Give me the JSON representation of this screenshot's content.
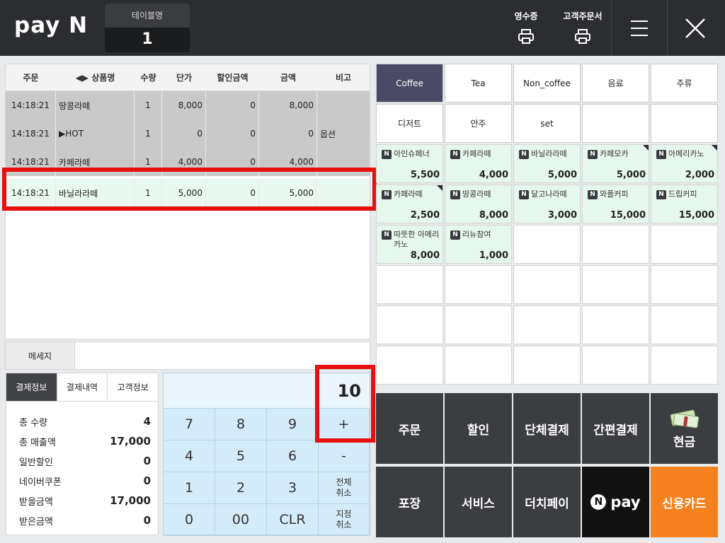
{
  "header": {
    "logo": "pay N",
    "table_label": "테이블명",
    "table_number": "1",
    "receipt_label": "영수증",
    "customer_order_label": "고객주문서"
  },
  "order_table": {
    "columns": [
      "주문",
      "◀▶ 상품명",
      "수량",
      "단가",
      "할인금액",
      "금액",
      "비고"
    ],
    "rows": [
      {
        "time": "14:18:21",
        "name": "땅콩라떼",
        "qty": "1",
        "price": "8,000",
        "discount": "0",
        "amount": "8,000",
        "note": ""
      },
      {
        "time": "14:18:21",
        "name": "▶HOT",
        "qty": "1",
        "price": "0",
        "discount": "0",
        "amount": "0",
        "note": "옵션"
      },
      {
        "time": "14:18:21",
        "name": "카페라떼",
        "qty": "1",
        "price": "4,000",
        "discount": "0",
        "amount": "4,000",
        "note": ""
      },
      {
        "time": "14:18:21",
        "name": "바닐라라떼",
        "qty": "1",
        "price": "5,000",
        "discount": "0",
        "amount": "5,000",
        "note": ""
      }
    ]
  },
  "message": {
    "label": "메세지"
  },
  "info": {
    "tabs": [
      "결제정보",
      "결제내역",
      "고객정보"
    ],
    "rows": [
      {
        "label": "총 수량",
        "value": "4"
      },
      {
        "label": "총 매출액",
        "value": "17,000"
      },
      {
        "label": "일반할인",
        "value": "0"
      },
      {
        "label": "네이버쿠폰",
        "value": "0"
      },
      {
        "label": "받을금액",
        "value": "17,000"
      },
      {
        "label": "받은금액",
        "value": "0"
      }
    ]
  },
  "keypad": {
    "display": "10",
    "keys": [
      "7",
      "8",
      "9",
      "+",
      "4",
      "5",
      "6",
      "-",
      "1",
      "2",
      "3",
      "전체\n취소",
      "0",
      "00",
      "CLR",
      "지정\n취소"
    ]
  },
  "categories": [
    "Coffee",
    "Tea",
    "Non_coffee",
    "음료",
    "주류",
    "디저트",
    "안주",
    "set",
    "",
    ""
  ],
  "menu_items": [
    {
      "name": "아인슈페너",
      "price": "5,500",
      "corner": false
    },
    {
      "name": "카페라떼",
      "price": "4,000",
      "corner": false
    },
    {
      "name": "바닐라라떼",
      "price": "5,000",
      "corner": false
    },
    {
      "name": "카페모카",
      "price": "5,000",
      "corner": true
    },
    {
      "name": "아메리카노",
      "price": "2,000",
      "corner": true
    },
    {
      "name": "카페라떼",
      "price": "2,500",
      "corner": true
    },
    {
      "name": "땅콩라떼",
      "price": "8,000",
      "corner": false
    },
    {
      "name": "달고나라떼",
      "price": "3,000",
      "corner": false
    },
    {
      "name": "와플커피",
      "price": "15,000",
      "corner": false
    },
    {
      "name": "드립커피",
      "price": "15,000",
      "corner": false
    },
    {
      "name": "따뜻한 아메리카노",
      "price": "8,000",
      "corner": false
    },
    {
      "name": "리뉴참여",
      "price": "1,000",
      "corner": false
    }
  ],
  "actions": [
    "주문",
    "할인",
    "단체결제",
    "간편결제",
    "현금",
    "포장",
    "서비스",
    "더치페이",
    "pay",
    "신용카드"
  ],
  "colors": {
    "accent_category": "#4b4a66",
    "card_button": "#f5821f",
    "highlight": "#e80f0f",
    "selected_row": "#e9f8f0"
  }
}
